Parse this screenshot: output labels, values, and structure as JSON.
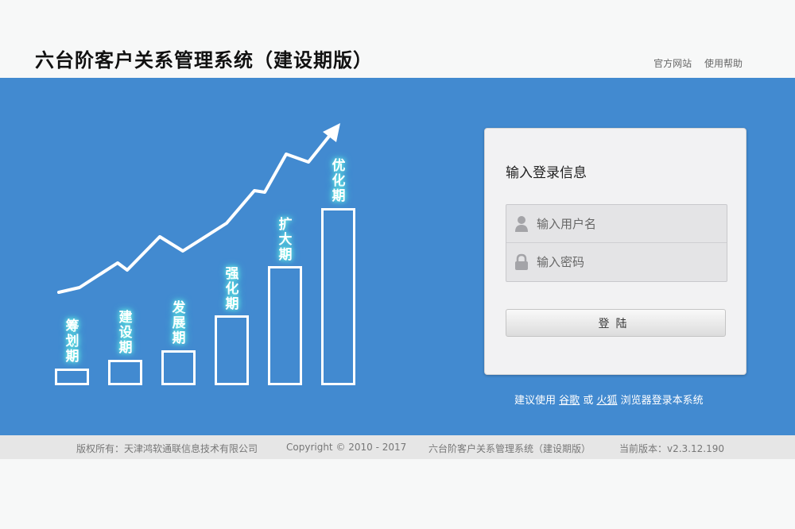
{
  "header": {
    "title": "六台阶客户关系管理系统（建设期版）",
    "links": [
      "官方网站",
      "使用帮助"
    ]
  },
  "stages": [
    {
      "label": "筹划期"
    },
    {
      "label": "建设期"
    },
    {
      "label": "发展期"
    },
    {
      "label": "强化期"
    },
    {
      "label": "扩大期"
    },
    {
      "label": "优化期"
    }
  ],
  "login": {
    "title": "输入登录信息",
    "username_placeholder": "输入用户名",
    "password_placeholder": "输入密码",
    "submit_label": "登陆"
  },
  "browser_tip": {
    "prefix": "建议使用",
    "chrome": "谷歌",
    "or": "或",
    "firefox": "火狐",
    "suffix": "浏览器登录本系统"
  },
  "footer": {
    "copyright_owner": "版权所有：天津鸿软通联信息技术有限公司",
    "copyright": "Copyright © 2010 - 2017",
    "product": "六台阶客户关系管理系统（建设期版）",
    "version": "当前版本：v2.3.12.190"
  },
  "colors": {
    "banner": "#428ad0",
    "label_glow": "#6ff5e8"
  }
}
